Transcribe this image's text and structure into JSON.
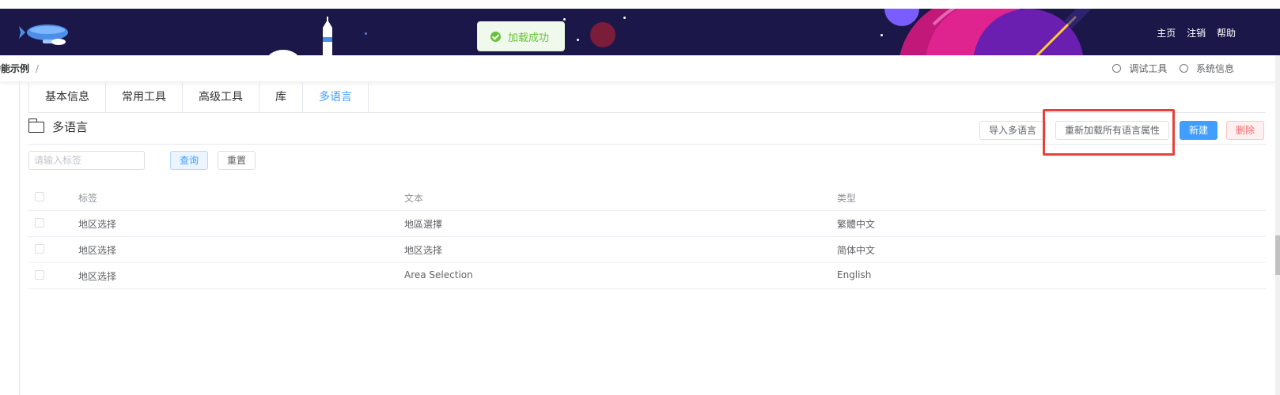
{
  "header": {
    "nav": [
      "主页",
      "注销",
      "帮助"
    ]
  },
  "toast": {
    "message": "加载成功"
  },
  "breadcrumb": {
    "current": "功能示例",
    "separator": "/"
  },
  "toolbar_right": {
    "debug_tool": "调试工具",
    "system_info": "系统信息"
  },
  "tabs": [
    {
      "label": "基本信息",
      "active": false
    },
    {
      "label": "常用工具",
      "active": false
    },
    {
      "label": "高级工具",
      "active": false
    },
    {
      "label": "库",
      "active": false
    },
    {
      "label": "多语言",
      "active": true
    }
  ],
  "section": {
    "title": "多语言",
    "actions": {
      "import": "导入多语言",
      "reload": "重新加载所有语言属性",
      "new": "新建",
      "delete": "删除"
    }
  },
  "search": {
    "placeholder": "请输入标签",
    "query_label": "查询",
    "reset_label": "重置"
  },
  "table": {
    "columns": [
      "标签",
      "文本",
      "类型"
    ],
    "rows": [
      [
        "地区选择",
        "地區選擇",
        "繁體中文"
      ],
      [
        "地区选择",
        "地区选择",
        "简体中文"
      ],
      [
        "地区选择",
        "Area Selection",
        "English"
      ]
    ]
  },
  "colors": {
    "banner": "#1b1748",
    "primary": "#409eff",
    "danger": "#f56c6c",
    "success": "#67c23a",
    "highlight": "#e8413b"
  }
}
